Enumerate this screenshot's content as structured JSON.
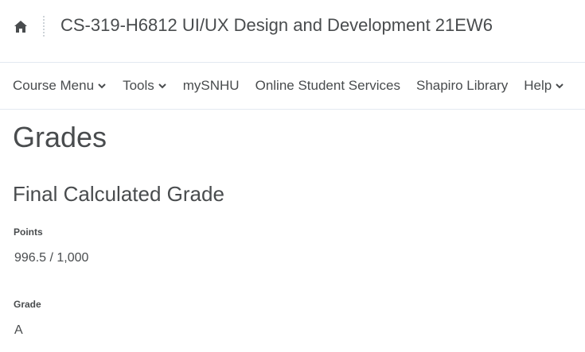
{
  "header": {
    "course_title": "CS-319-H6812 UI/UX Design and Development 21EW6",
    "home_icon": "home-icon"
  },
  "nav": {
    "items": [
      {
        "label": "Course Menu",
        "has_dropdown": true
      },
      {
        "label": "Tools",
        "has_dropdown": true
      },
      {
        "label": "mySNHU",
        "has_dropdown": false
      },
      {
        "label": "Online Student Services",
        "has_dropdown": false
      },
      {
        "label": "Shapiro Library",
        "has_dropdown": false
      },
      {
        "label": "Help",
        "has_dropdown": true
      }
    ]
  },
  "main": {
    "page_title": "Grades",
    "section_title": "Final Calculated Grade",
    "points_label": "Points",
    "points_value": "996.5 / 1,000",
    "grade_label": "Grade",
    "grade_value": "A"
  }
}
